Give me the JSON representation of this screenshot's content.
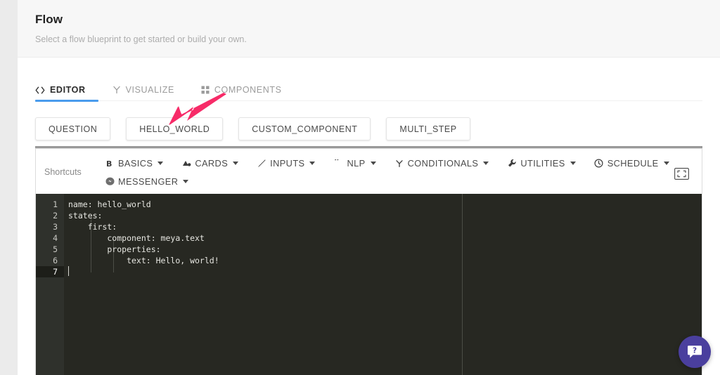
{
  "header": {
    "title": "Flow",
    "subtitle": "Select a flow blueprint to get started or build your own."
  },
  "tabs": [
    {
      "label": "EDITOR",
      "icon": "code-brackets-icon",
      "active": true
    },
    {
      "label": "VISUALIZE",
      "icon": "branch-icon",
      "active": false
    },
    {
      "label": "COMPONENTS",
      "icon": "grid-icon",
      "active": false
    }
  ],
  "blueprints": [
    {
      "label": "QUESTION"
    },
    {
      "label": "HELLO_WORLD"
    },
    {
      "label": "CUSTOM_COMPONENT"
    },
    {
      "label": "MULTI_STEP"
    }
  ],
  "shortcuts": {
    "label": "Shortcuts",
    "items": [
      {
        "label": "BASICS",
        "icon": "bold-b-icon"
      },
      {
        "label": "CARDS",
        "icon": "cards-icon"
      },
      {
        "label": "INPUTS",
        "icon": "pencil-icon"
      },
      {
        "label": "NLP",
        "icon": "quote-icon"
      },
      {
        "label": "CONDITIONALS",
        "icon": "branch-icon"
      },
      {
        "label": "UTILITIES",
        "icon": "wrench-icon"
      },
      {
        "label": "SCHEDULE",
        "icon": "clock-icon"
      },
      {
        "label": "MESSENGER",
        "icon": "messenger-icon"
      }
    ],
    "fullscreen_icon": "fullscreen-icon"
  },
  "editor": {
    "line_numbers": [
      "1",
      "2",
      "3",
      "4",
      "5",
      "6",
      "7"
    ],
    "lines": [
      "name: hello_world",
      "states:",
      "    first:",
      "        component: meya.text",
      "        properties:",
      "            text: Hello, world!",
      ""
    ],
    "active_line": 7
  },
  "annotation": {
    "arrow_target": "HELLO_WORLD",
    "arrow_color": "#f72b68"
  },
  "help": {
    "icon": "help-chat-icon",
    "glyph": "?",
    "color": "#4a3f9e"
  },
  "colors": {
    "accent_blue": "#4a9ced",
    "header_bg": "#f7f7f7",
    "editor_bg": "#272822",
    "gutter_bg": "#2f312c"
  }
}
